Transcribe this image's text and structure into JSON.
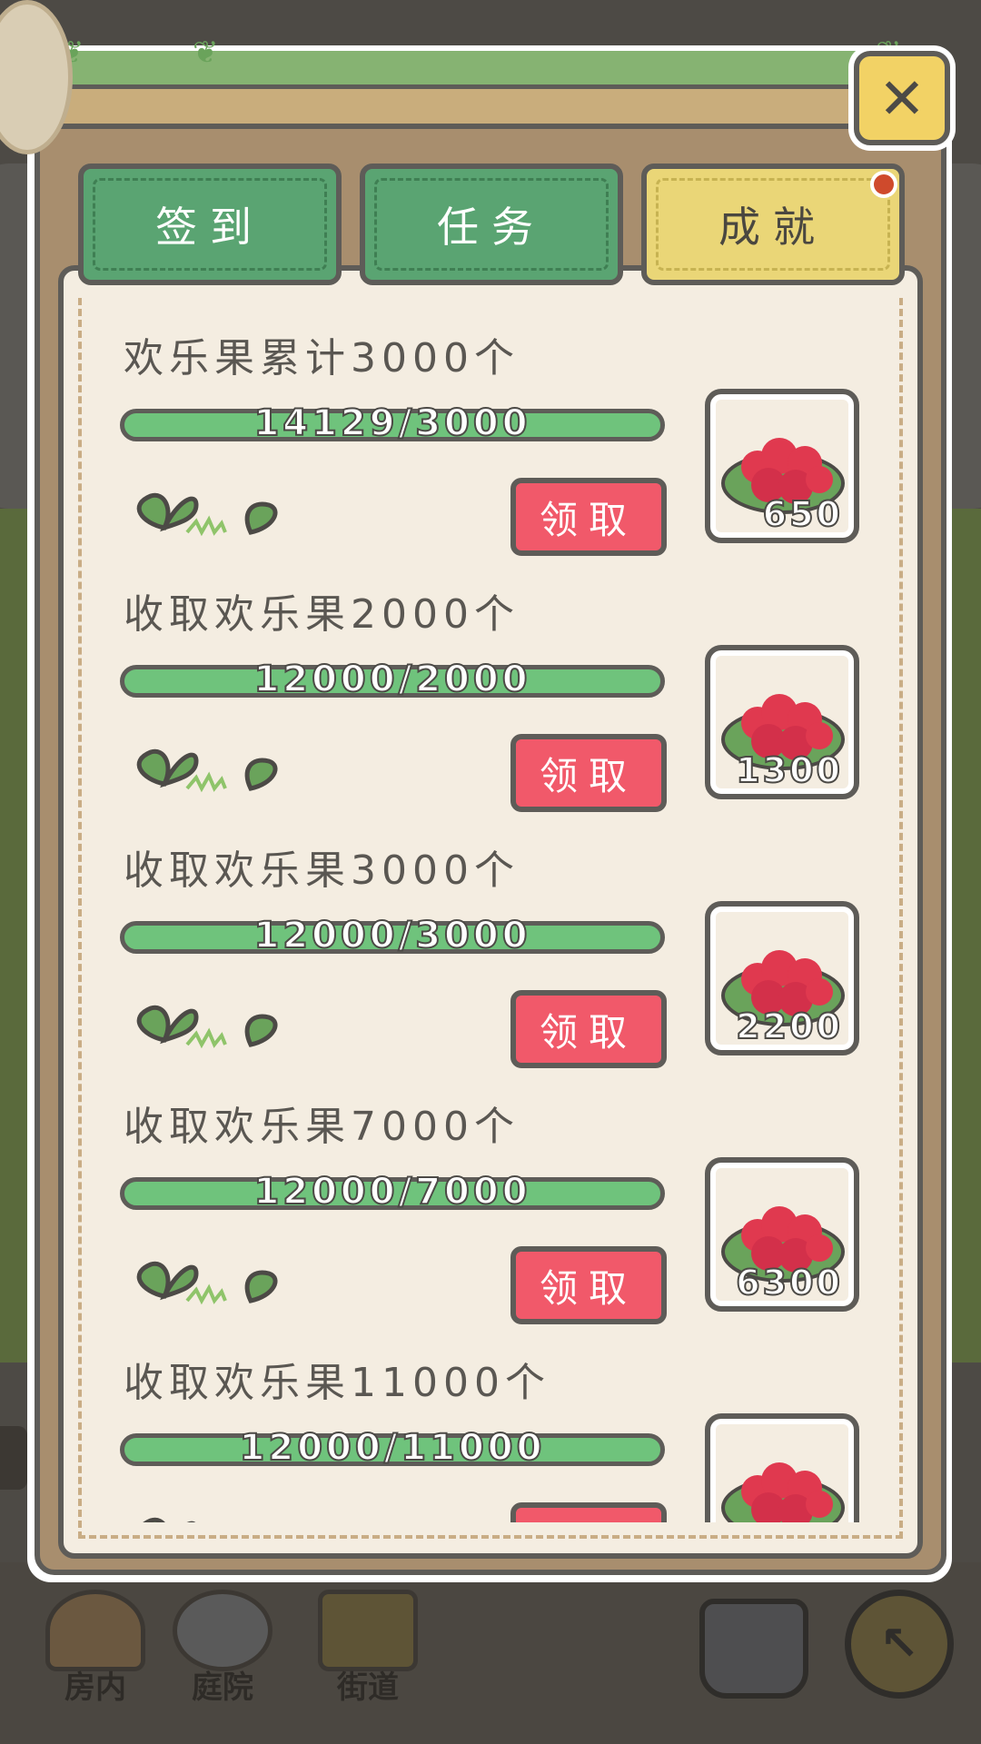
{
  "tabs": [
    {
      "label": "签到",
      "active": false
    },
    {
      "label": "任务",
      "active": false
    },
    {
      "label": "成就",
      "active": true
    }
  ],
  "close_label": "✕",
  "claim_label": "领取",
  "achievements": [
    {
      "title": "欢乐果累计3000个",
      "progress": "14129/3000",
      "reward": "650"
    },
    {
      "title": "收取欢乐果2000个",
      "progress": "12000/2000",
      "reward": "1300"
    },
    {
      "title": "收取欢乐果3000个",
      "progress": "12000/3000",
      "reward": "2200"
    },
    {
      "title": "收取欢乐果7000个",
      "progress": "12000/7000",
      "reward": "6300"
    },
    {
      "title": "收取欢乐果11000个",
      "progress": "12000/11000",
      "reward": ""
    }
  ],
  "bottom_nav": {
    "items": [
      {
        "label": "房内"
      },
      {
        "label": "庭院"
      },
      {
        "label": "街道"
      }
    ]
  },
  "colors": {
    "tab_green": "#5aa472",
    "tab_active": "#ead677",
    "progress_green": "#6fc37c",
    "claim_red": "#f1596a",
    "sheet_bg": "#f4ede1",
    "frame_brown": "#a88e6e"
  }
}
